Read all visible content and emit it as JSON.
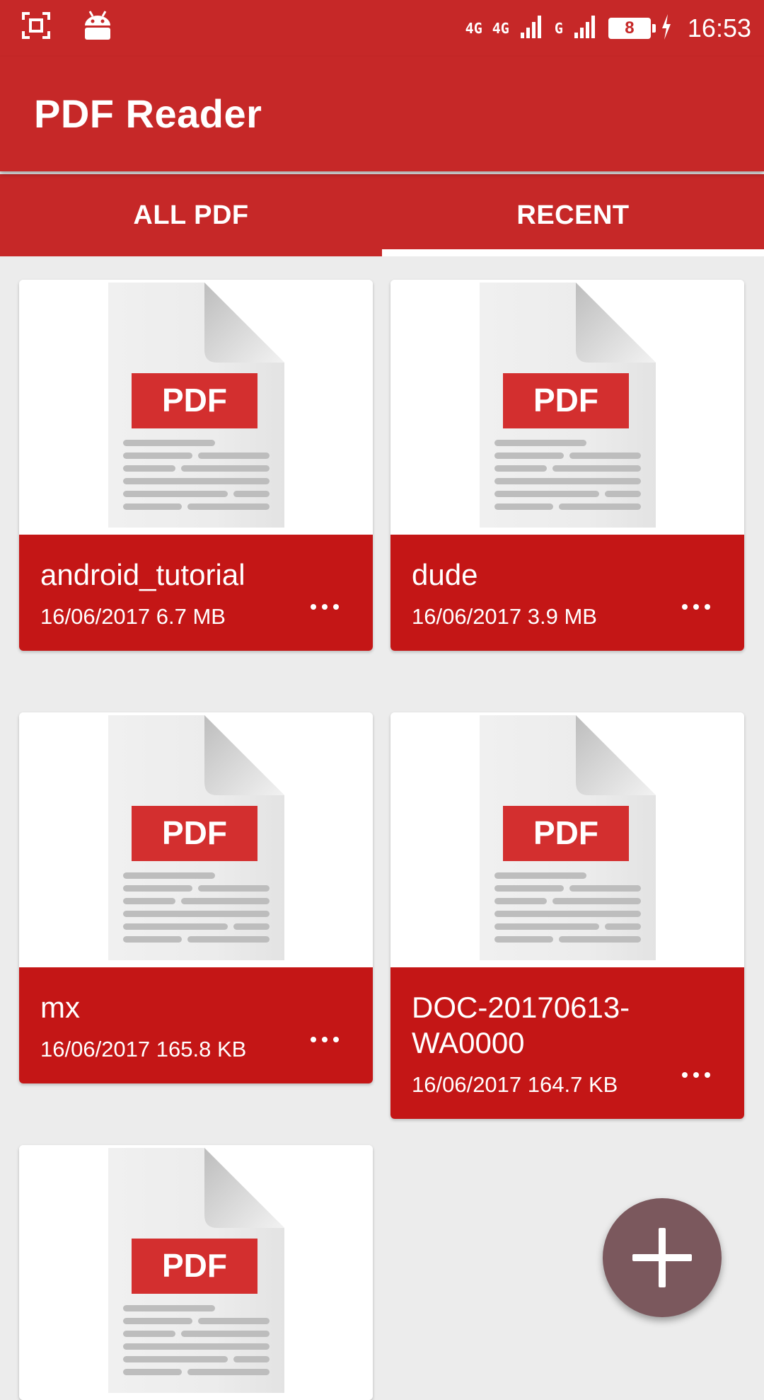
{
  "status_bar": {
    "left_icons": [
      "screenshot-icon",
      "android-icon"
    ],
    "network_1": "4G",
    "network_2": "4G",
    "network_3": "G",
    "battery_level": "8",
    "time": "16:53"
  },
  "app_bar": {
    "title": "PDF Reader"
  },
  "tabs": [
    {
      "label": "ALL PDF",
      "active": false
    },
    {
      "label": "RECENT",
      "active": true
    }
  ],
  "thumbnail_badge": "PDF",
  "files": [
    {
      "name": "android_tutorial",
      "meta": "16/06/2017 6.7 MB"
    },
    {
      "name": "dude",
      "meta": "16/06/2017 3.9 MB"
    },
    {
      "name": "mx",
      "meta": "16/06/2017 165.8 KB"
    },
    {
      "name": "DOC-20170613-WA0000",
      "meta": "16/06/2017 164.7 KB"
    },
    {
      "name": "",
      "meta": ""
    }
  ],
  "colors": {
    "primary": "#c62828",
    "card_footer": "#c41616",
    "fab": "#7b585d",
    "background": "#ececec"
  },
  "fab": {
    "icon": "plus-icon"
  }
}
